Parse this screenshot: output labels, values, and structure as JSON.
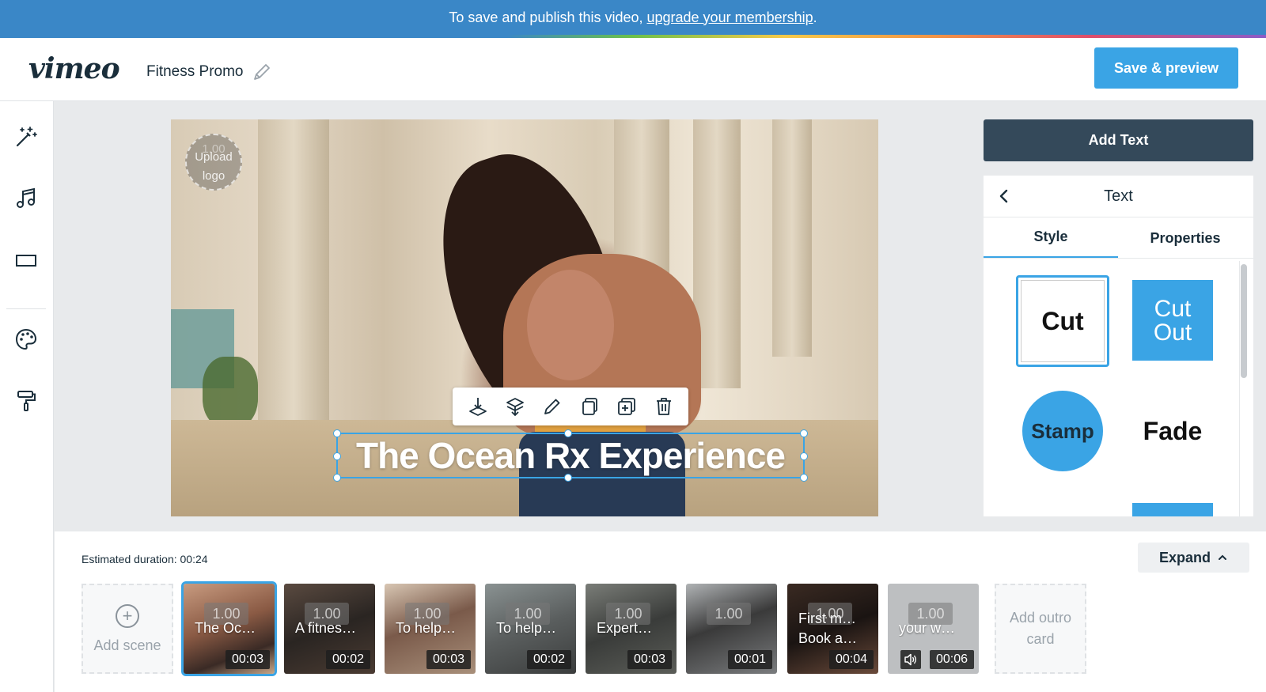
{
  "banner": {
    "text": "To save and publish this video,",
    "link": "upgrade your membership",
    "suffix": "."
  },
  "header": {
    "logo": "vimeo",
    "project_title": "Fitness Promo",
    "save_label": "Save & preview"
  },
  "sidebar": {
    "items": [
      {
        "icon": "magic-wand-icon"
      },
      {
        "icon": "music-note-icon"
      },
      {
        "icon": "aspect-ratio-icon"
      },
      {
        "icon": "palette-icon"
      },
      {
        "icon": "paint-roller-icon"
      }
    ]
  },
  "preview": {
    "upload_logo_version": "1.00",
    "upload_logo_label": "Upload logo",
    "overlay_text": "The Ocean Rx Experience",
    "toolbar": [
      "layer-forward-icon",
      "layer-backward-icon",
      "edit-icon",
      "copy-icon",
      "duplicate-icon",
      "delete-icon"
    ]
  },
  "right_panel": {
    "add_text_label": "Add Text",
    "title": "Text",
    "tabs": [
      "Style",
      "Properties"
    ],
    "styles": {
      "cut": "Cut",
      "cut_out_line1": "Cut",
      "cut_out_line2": "Out",
      "stamp": "Stamp",
      "fade": "Fade"
    }
  },
  "timeline": {
    "estimated_duration": "Estimated duration: 00:24",
    "expand_label": "Expand",
    "add_scene_label": "Add scene",
    "add_outro_label": "Add outro card",
    "scenes": [
      {
        "version": "1.00",
        "text": "The Oc…",
        "duration": "00:03",
        "selected": true
      },
      {
        "version": "1.00",
        "text": "A fitnes…",
        "duration": "00:02"
      },
      {
        "version": "1.00",
        "text": "To help…",
        "duration": "00:03"
      },
      {
        "version": "1.00",
        "text": "To help…",
        "duration": "00:02"
      },
      {
        "version": "1.00",
        "text": "Expert…",
        "duration": "00:03"
      },
      {
        "version": "1.00",
        "text": "",
        "duration": "00:01"
      },
      {
        "version": "1.00",
        "text": "First m… Book a…",
        "duration": "00:04"
      },
      {
        "version": "1.00",
        "text": "your w…",
        "duration": "00:06"
      }
    ]
  },
  "colors": {
    "banner": "#3a87c7",
    "accent": "#3aa4e5",
    "dark_button": "#34495a"
  }
}
